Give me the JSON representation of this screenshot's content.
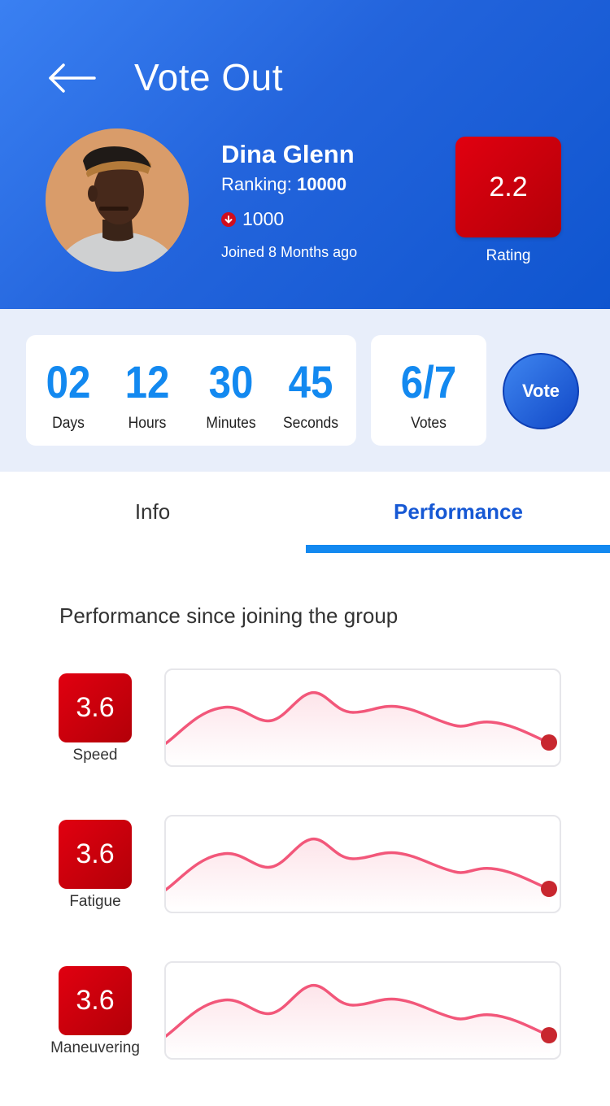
{
  "header": {
    "title": "Vote Out",
    "back_icon": "arrow-left-icon"
  },
  "profile": {
    "name": "Dina Glenn",
    "ranking_label": "Ranking:",
    "ranking_value": "10000",
    "points": "1000",
    "points_icon": "arrow-down-circle-icon",
    "joined": "Joined 8 Months ago"
  },
  "rating": {
    "value": "2.2",
    "label": "Rating"
  },
  "countdown": [
    {
      "value": "02",
      "label": "Days"
    },
    {
      "value": "12",
      "label": "Hours"
    },
    {
      "value": "30",
      "label": "Minutes"
    },
    {
      "value": "45",
      "label": "Seconds"
    }
  ],
  "votes": {
    "value": "6/7",
    "label": "Votes"
  },
  "vote_button": "Vote",
  "tabs": [
    {
      "label": "Info",
      "active": false
    },
    {
      "label": "Performance",
      "active": true
    }
  ],
  "performance": {
    "title": "Performance since joining the group",
    "metrics": [
      {
        "label": "Speed",
        "value": "3.6"
      },
      {
        "label": "Fatigue",
        "value": "3.6"
      },
      {
        "label": "Maneuvering",
        "value": "3.6"
      }
    ]
  },
  "colors": {
    "header_gradient_start": "#3a80f2",
    "header_gradient_end": "#0f55cf",
    "accent_blue": "#1389f0",
    "active_tab": "#1658d4",
    "badge_red": "#d10010",
    "sparkline": "#f2577a",
    "sparkline_dot": "#c8272f"
  }
}
